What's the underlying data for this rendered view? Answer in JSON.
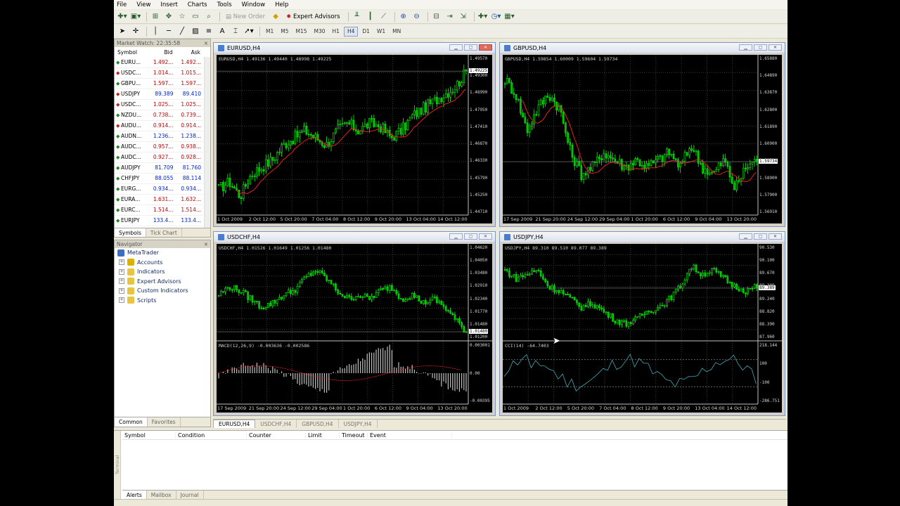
{
  "menu": [
    "File",
    "View",
    "Insert",
    "Charts",
    "Tools",
    "Window",
    "Help"
  ],
  "toolbar": {
    "new_order": "New Order",
    "expert_advisors": "Expert Advisors",
    "timeframes": [
      "M1",
      "M5",
      "M15",
      "M30",
      "H1",
      "H4",
      "D1",
      "W1",
      "MN"
    ],
    "active_timeframe": "H4"
  },
  "market_watch": {
    "title": "Market Watch: 22:35:58",
    "columns": [
      "Symbol",
      "Bid",
      "Ask"
    ],
    "rows": [
      {
        "symbol": "EURU...",
        "bid": "1.492...",
        "ask": "1.492...",
        "dir": "up",
        "color": "red"
      },
      {
        "symbol": "USDC...",
        "bid": "1.014...",
        "ask": "1.015...",
        "dir": "dn",
        "color": "red"
      },
      {
        "symbol": "GBPU...",
        "bid": "1.597...",
        "ask": "1.597...",
        "dir": "up",
        "color": "red"
      },
      {
        "symbol": "USDJPY",
        "bid": "89.389",
        "ask": "89.410",
        "dir": "dn",
        "color": "blue"
      },
      {
        "symbol": "USDC...",
        "bid": "1.025...",
        "ask": "1.025...",
        "dir": "dn",
        "color": "red"
      },
      {
        "symbol": "NZDU...",
        "bid": "0.738...",
        "ask": "0.739...",
        "dir": "up",
        "color": "red"
      },
      {
        "symbol": "AUDU...",
        "bid": "0.914...",
        "ask": "0.914...",
        "dir": "dn",
        "color": "red"
      },
      {
        "symbol": "AUDN...",
        "bid": "1.236...",
        "ask": "1.238...",
        "dir": "up",
        "color": "blue"
      },
      {
        "symbol": "AUDC...",
        "bid": "0.957...",
        "ask": "0.938...",
        "dir": "up",
        "color": "red"
      },
      {
        "symbol": "AUDC...",
        "bid": "0.927...",
        "ask": "0.928...",
        "dir": "up",
        "color": "red"
      },
      {
        "symbol": "AUDJPY",
        "bid": "81.709",
        "ask": "81.760",
        "dir": "up",
        "color": "blue"
      },
      {
        "symbol": "CHFJPY",
        "bid": "88.055",
        "ask": "88.114",
        "dir": "up",
        "color": "blue"
      },
      {
        "symbol": "EURG...",
        "bid": "0.934...",
        "ask": "0.934...",
        "dir": "up",
        "color": "blue"
      },
      {
        "symbol": "EURA...",
        "bid": "1.631...",
        "ask": "1.632...",
        "dir": "up",
        "color": "red"
      },
      {
        "symbol": "EURC...",
        "bid": "1.514...",
        "ask": "1.514...",
        "dir": "up",
        "color": "red"
      },
      {
        "symbol": "EURJPY",
        "bid": "133.4...",
        "ask": "133.4...",
        "dir": "up",
        "color": "blue"
      }
    ],
    "tabs": [
      "Symbols",
      "Tick Chart"
    ]
  },
  "navigator": {
    "title": "Navigator",
    "root": "MetaTrader",
    "items": [
      "Accounts",
      "Indicators",
      "Expert Advisors",
      "Custom Indicators",
      "Scripts"
    ],
    "tabs": [
      "Common",
      "Favorites"
    ]
  },
  "charts": [
    {
      "title": "EURUSD,H4",
      "info": "EURUSD,H4 1.49136 1.49440 1.48998 1.49225",
      "prices": [
        "1.49570",
        "1.49300",
        "1.48990",
        "1.47950",
        "1.47410",
        "1.46870",
        "1.46330",
        "1.45790",
        "1.45250",
        "1.44710"
      ],
      "tag": "1.49225",
      "times": [
        "1 Oct 2009",
        "2 Oct 12:00",
        "5 Oct 20:00",
        "7 Oct 04:00",
        "8 Oct 12:00",
        "9 Oct 20:00",
        "13 Oct 04:00",
        "14 Oct 12:00"
      ],
      "indicator": null
    },
    {
      "title": "GBPUSD,H4",
      "info": "GBPUSD,H4 1.59854 1.60009 1.59604 1.59734",
      "prices": [
        "1.65880",
        "1.64890",
        "1.63870",
        "1.62800",
        "1.61890",
        "1.60900",
        "1.59734",
        "1.58900",
        "1.57900",
        "1.56910"
      ],
      "tag": "1.59734",
      "times": [
        "17 Sep 2009",
        "21 Sep 20:00",
        "24 Sep 12:00",
        "29 Sep 04:00",
        "1 Oct 20:00",
        "6 Oct 12:00",
        "9 Oct 04:00",
        "13 Oct 20:00"
      ],
      "indicator": null
    },
    {
      "title": "USDCHF,H4",
      "info": "USDCHF,H4 1.01526 1.01649 1.01256 1.01480",
      "prices": [
        "1.04620",
        "1.04050",
        "1.03480",
        "1.02910",
        "1.02340",
        "1.01770",
        "1.01480",
        "1.01200"
      ],
      "tag": "1.01480",
      "times": [
        "17 Sep 2009",
        "21 Sep 20:00",
        "24 Sep 12:00",
        "29 Sep 04:00",
        "1 Oct 20:00",
        "6 Oct 12:00",
        "9 Oct 04:00",
        "13 Oct 20:00"
      ],
      "indicator": {
        "info": "MACD(12,26,9) -0.003636 -0.002586",
        "scale": [
          "0.003001",
          "0.00",
          "-0.00395"
        ]
      }
    },
    {
      "title": "USDJPY,H4",
      "info": "USDJPY,H4 89.310 89.510 89.077 89.389",
      "prices": [
        "90.530",
        "90.100",
        "89.670",
        "89.389",
        "89.240",
        "88.820",
        "88.390",
        "87.960"
      ],
      "tag": "89.389",
      "times": [
        "1 Oct 2009",
        "2 Oct 12:00",
        "5 Oct 20:00",
        "7 Oct 04:00",
        "8 Oct 12:00",
        "9 Oct 20:00",
        "13 Oct 04:00",
        "14 Oct 12:00"
      ],
      "indicator": {
        "info": "CCI(14) -64.7403",
        "scale": [
          "218.144",
          "100",
          "-100",
          "-286.751"
        ]
      }
    }
  ],
  "chart_tabs": [
    "EURUSD,H4",
    "USDCHF,H4",
    "GBPUSD,H4",
    "USDJPY,H4"
  ],
  "terminal": {
    "columns": [
      "Symbol",
      "Condition",
      "Counter",
      "Limit",
      "Timeout",
      "Event"
    ],
    "tabs": [
      "Alerts",
      "Mailbox",
      "Journal"
    ],
    "side_label": "Terminal"
  },
  "colors": {
    "bull": "#00ff00",
    "bear": "#00b000",
    "ma": "#ff2020",
    "cci": "#3fa9b5",
    "macd": "#c0c0c0"
  }
}
